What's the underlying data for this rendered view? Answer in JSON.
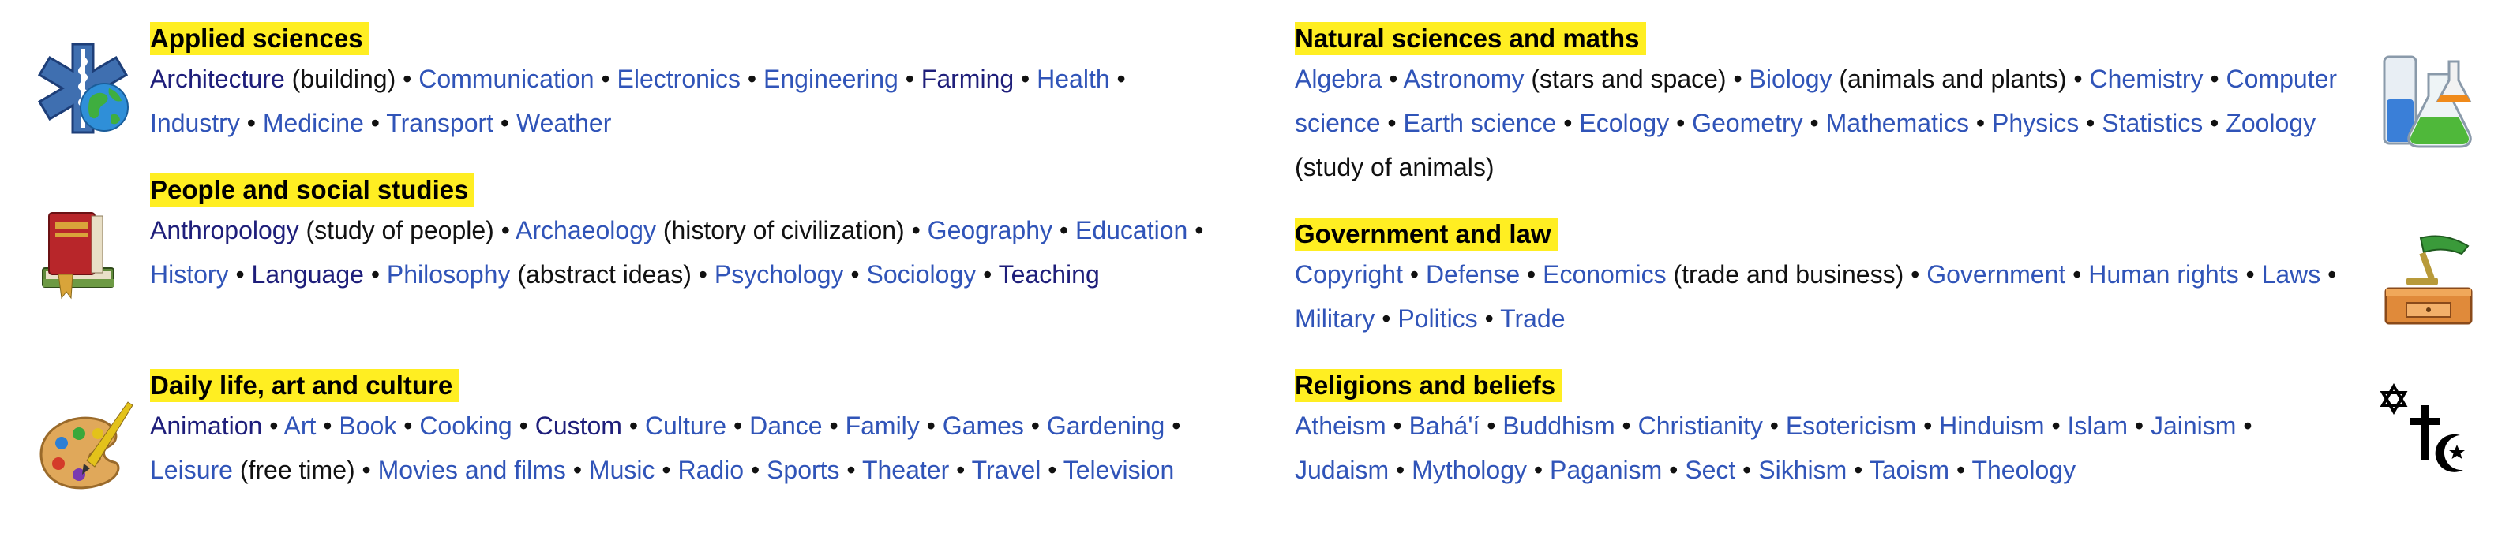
{
  "left_sections": [
    {
      "id": "applied",
      "icon": "medical-globe-icon",
      "heading": "Applied sciences",
      "items": [
        {
          "label": "Architecture",
          "note": "(building)",
          "visited": true
        },
        {
          "label": "Communication"
        },
        {
          "label": "Electronics"
        },
        {
          "label": "Engineering"
        },
        {
          "label": "Farming",
          "visited": true
        },
        {
          "label": "Health"
        },
        {
          "label": "Industry"
        },
        {
          "label": "Medicine"
        },
        {
          "label": "Transport"
        },
        {
          "label": "Weather"
        }
      ]
    },
    {
      "id": "people",
      "icon": "books-icon",
      "heading": "People and social studies",
      "items": [
        {
          "label": "Anthropology",
          "note": "(study of people)",
          "visited": true
        },
        {
          "label": "Archaeology",
          "note": "(history of civilization)"
        },
        {
          "label": "Geography"
        },
        {
          "label": "Education"
        },
        {
          "label": "History"
        },
        {
          "label": "Language",
          "visited": true
        },
        {
          "label": "Philosophy",
          "note": "(abstract ideas)"
        },
        {
          "label": "Psychology"
        },
        {
          "label": "Sociology"
        },
        {
          "label": "Teaching",
          "visited": true
        }
      ]
    },
    {
      "id": "daily",
      "icon": "palette-icon",
      "heading": "Daily life, art and culture",
      "items": [
        {
          "label": "Animation",
          "visited": true
        },
        {
          "label": "Art"
        },
        {
          "label": "Book"
        },
        {
          "label": "Cooking"
        },
        {
          "label": "Custom",
          "visited": true
        },
        {
          "label": "Culture"
        },
        {
          "label": "Dance"
        },
        {
          "label": "Family"
        },
        {
          "label": "Games"
        },
        {
          "label": "Gardening"
        },
        {
          "label": "Leisure",
          "note": "(free time)"
        },
        {
          "label": "Movies and films"
        },
        {
          "label": "Music"
        },
        {
          "label": "Radio"
        },
        {
          "label": "Sports"
        },
        {
          "label": "Theater"
        },
        {
          "label": "Travel"
        },
        {
          "label": "Television"
        }
      ]
    }
  ],
  "right_sections": [
    {
      "id": "natural",
      "icon": "laboratory-flasks-icon",
      "heading": "Natural sciences and maths",
      "items": [
        {
          "label": "Algebra"
        },
        {
          "label": "Astronomy",
          "note": "(stars and space)"
        },
        {
          "label": "Biology",
          "note": "(animals and plants)"
        },
        {
          "label": "Chemistry"
        },
        {
          "label": "Computer science"
        },
        {
          "label": "Earth science"
        },
        {
          "label": "Ecology"
        },
        {
          "label": "Geometry"
        },
        {
          "label": "Mathematics"
        },
        {
          "label": "Physics"
        },
        {
          "label": "Statistics"
        },
        {
          "label": "Zoology",
          "note": "(study of animals)"
        }
      ]
    },
    {
      "id": "government",
      "icon": "desk-lamp-icon",
      "heading": "Government and law",
      "items": [
        {
          "label": "Copyright"
        },
        {
          "label": "Defense"
        },
        {
          "label": "Economics",
          "note": "(trade and business)"
        },
        {
          "label": "Government"
        },
        {
          "label": "Human rights"
        },
        {
          "label": "Laws"
        },
        {
          "label": "Military"
        },
        {
          "label": "Politics"
        },
        {
          "label": "Trade"
        }
      ]
    },
    {
      "id": "religions",
      "icon": "religious-symbols-icon",
      "heading": "Religions and beliefs",
      "items": [
        {
          "label": "Atheism"
        },
        {
          "label": "Bahá'í"
        },
        {
          "label": "Buddhism"
        },
        {
          "label": "Christianity"
        },
        {
          "label": "Esotericism"
        },
        {
          "label": "Hinduism"
        },
        {
          "label": "Islam"
        },
        {
          "label": "Jainism"
        },
        {
          "label": "Judaism"
        },
        {
          "label": "Mythology"
        },
        {
          "label": "Paganism"
        },
        {
          "label": "Sect"
        },
        {
          "label": "Sikhism"
        },
        {
          "label": "Taoism"
        },
        {
          "label": "Theology"
        }
      ]
    }
  ],
  "colors": {
    "link": "#3054b8",
    "visited_link": "#1e1e7a",
    "heading_highlight": "#ffee22",
    "text": "#202122"
  },
  "separator": "•"
}
